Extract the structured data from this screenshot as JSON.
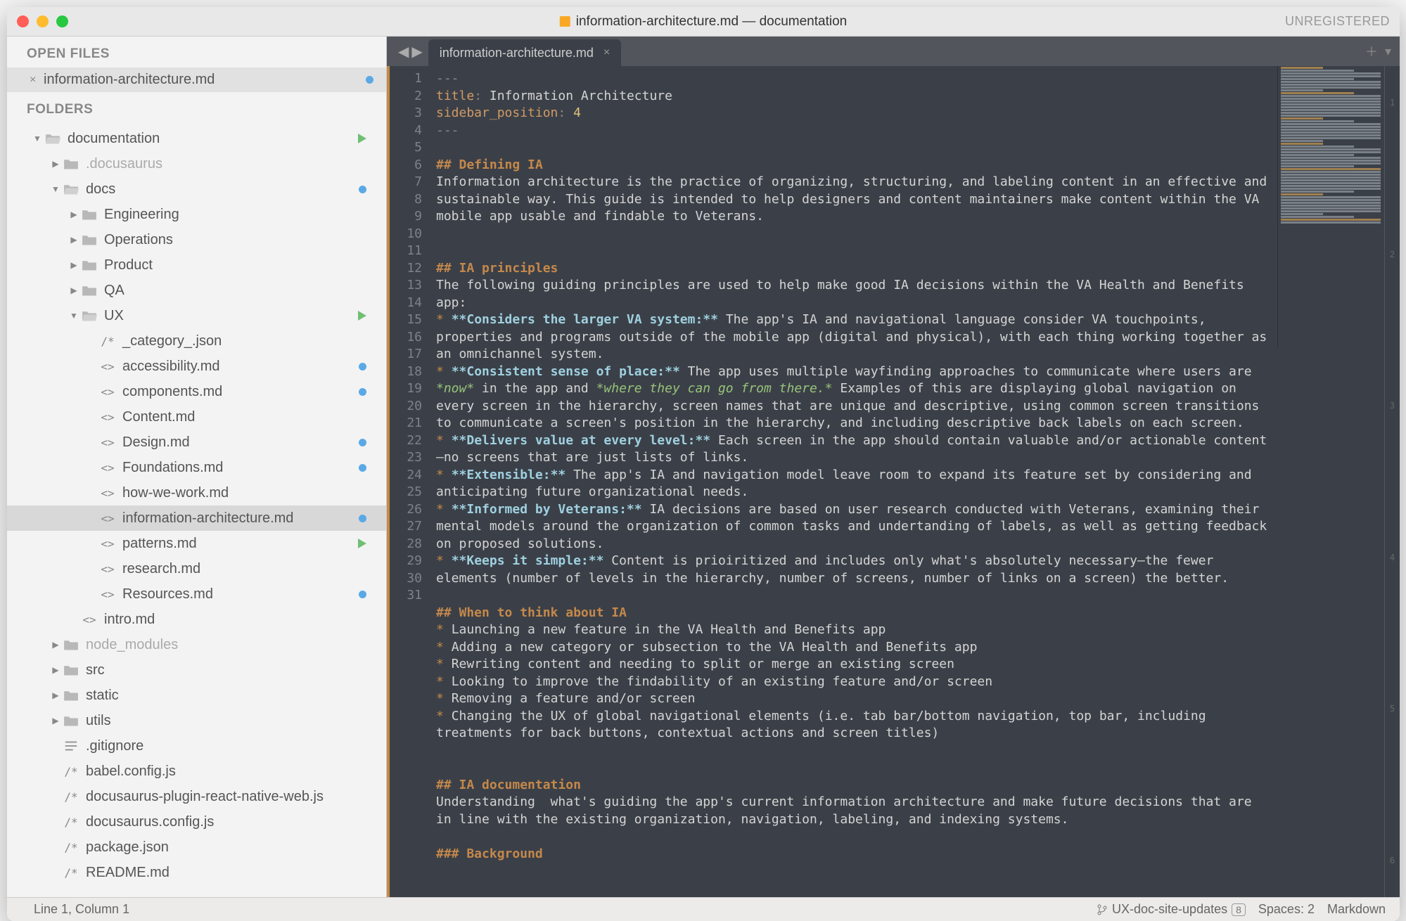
{
  "titlebar": {
    "title": "information-architecture.md — documentation",
    "unregistered": "UNREGISTERED"
  },
  "sidebar": {
    "open_files_header": "OPEN FILES",
    "open_file": "information-architecture.md",
    "folders_header": "FOLDERS",
    "tree": [
      {
        "depth": 1,
        "disc": "down",
        "icon": "folder-open",
        "label": "documentation",
        "badge": "pent"
      },
      {
        "depth": 2,
        "disc": "right",
        "icon": "folder",
        "label": ".docusaurus",
        "dim": true
      },
      {
        "depth": 2,
        "disc": "down",
        "icon": "folder-open",
        "label": "docs",
        "badge": "dot"
      },
      {
        "depth": 3,
        "disc": "right",
        "icon": "folder",
        "label": "Engineering"
      },
      {
        "depth": 3,
        "disc": "right",
        "icon": "folder",
        "label": "Operations"
      },
      {
        "depth": 3,
        "disc": "right",
        "icon": "folder",
        "label": "Product"
      },
      {
        "depth": 3,
        "disc": "right",
        "icon": "folder",
        "label": "QA"
      },
      {
        "depth": 3,
        "disc": "down",
        "icon": "folder-open",
        "label": "UX",
        "badge": "pent"
      },
      {
        "depth": 4,
        "disc": "",
        "icon": "js",
        "label": "_category_.json"
      },
      {
        "depth": 4,
        "disc": "",
        "icon": "angle",
        "label": "accessibility.md",
        "badge": "dot"
      },
      {
        "depth": 4,
        "disc": "",
        "icon": "angle",
        "label": "components.md",
        "badge": "dot"
      },
      {
        "depth": 4,
        "disc": "",
        "icon": "angle",
        "label": "Content.md"
      },
      {
        "depth": 4,
        "disc": "",
        "icon": "angle",
        "label": "Design.md",
        "badge": "dot"
      },
      {
        "depth": 4,
        "disc": "",
        "icon": "angle",
        "label": "Foundations.md",
        "badge": "dot"
      },
      {
        "depth": 4,
        "disc": "",
        "icon": "angle",
        "label": "how-we-work.md"
      },
      {
        "depth": 4,
        "disc": "",
        "icon": "angle",
        "label": "information-architecture.md",
        "badge": "dot",
        "selected": true
      },
      {
        "depth": 4,
        "disc": "",
        "icon": "angle",
        "label": "patterns.md",
        "badge": "pent"
      },
      {
        "depth": 4,
        "disc": "",
        "icon": "angle",
        "label": "research.md"
      },
      {
        "depth": 4,
        "disc": "",
        "icon": "angle",
        "label": "Resources.md",
        "badge": "dot"
      },
      {
        "depth": 3,
        "disc": "",
        "icon": "angle",
        "label": "intro.md"
      },
      {
        "depth": 2,
        "disc": "right",
        "icon": "folder",
        "label": "node_modules",
        "dim": true
      },
      {
        "depth": 2,
        "disc": "right",
        "icon": "folder",
        "label": "src"
      },
      {
        "depth": 2,
        "disc": "right",
        "icon": "folder",
        "label": "static"
      },
      {
        "depth": 2,
        "disc": "right",
        "icon": "folder",
        "label": "utils"
      },
      {
        "depth": 2,
        "disc": "",
        "icon": "lines",
        "label": ".gitignore"
      },
      {
        "depth": 2,
        "disc": "",
        "icon": "js",
        "label": "babel.config.js"
      },
      {
        "depth": 2,
        "disc": "",
        "icon": "js",
        "label": "docusaurus-plugin-react-native-web.js"
      },
      {
        "depth": 2,
        "disc": "",
        "icon": "js",
        "label": "docusaurus.config.js"
      },
      {
        "depth": 2,
        "disc": "",
        "icon": "js",
        "label": "package.json"
      },
      {
        "depth": 2,
        "disc": "",
        "icon": "js",
        "label": "README.md"
      }
    ]
  },
  "tab": {
    "label": "information-architecture.md"
  },
  "code_lines": [
    {
      "n": 1,
      "seg": [
        {
          "c": "punc",
          "t": "---"
        }
      ]
    },
    {
      "n": 2,
      "seg": [
        {
          "c": "key",
          "t": "title"
        },
        {
          "c": "punc",
          "t": ": "
        },
        {
          "c": "",
          "t": "Information Architecture"
        }
      ]
    },
    {
      "n": 3,
      "seg": [
        {
          "c": "key",
          "t": "sidebar_position"
        },
        {
          "c": "punc",
          "t": ": "
        },
        {
          "c": "num",
          "t": "4"
        }
      ]
    },
    {
      "n": 4,
      "seg": [
        {
          "c": "punc",
          "t": "---"
        }
      ]
    },
    {
      "n": 5,
      "seg": []
    },
    {
      "n": 6,
      "seg": [
        {
          "c": "head",
          "t": "## Defining IA"
        }
      ]
    },
    {
      "n": 7,
      "seg": [
        {
          "c": "",
          "t": "Information architecture is the practice of organizing, structuring, and labeling content in an effective and sustainable way. This guide is intended to help designers and content maintainers make content within the VA mobile app usable and findable to Veterans."
        }
      ]
    },
    {
      "n": 8,
      "seg": []
    },
    {
      "n": 9,
      "seg": []
    },
    {
      "n": 10,
      "seg": [
        {
          "c": "head",
          "t": "## IA principles"
        }
      ]
    },
    {
      "n": 11,
      "seg": [
        {
          "c": "",
          "t": "The following guiding principles are used to help make good IA decisions within the VA Health and Benefits app:"
        }
      ]
    },
    {
      "n": 12,
      "seg": [
        {
          "c": "star",
          "t": "* "
        },
        {
          "c": "bold",
          "t": "**Considers the larger VA system:**"
        },
        {
          "c": "",
          "t": " The app's IA and navigational language consider VA touchpoints, properties and programs outside of the mobile app (digital and physical), with each thing working together as an omnichannel system."
        }
      ]
    },
    {
      "n": 13,
      "seg": [
        {
          "c": "star",
          "t": "* "
        },
        {
          "c": "bold",
          "t": "**Consistent sense of place:**"
        },
        {
          "c": "",
          "t": " The app uses multiple wayfinding approaches to communicate where users are "
        },
        {
          "c": "ital",
          "t": "*now*"
        },
        {
          "c": "",
          "t": " in the app and "
        },
        {
          "c": "ital",
          "t": "*where they can go from there.*"
        },
        {
          "c": "",
          "t": " Examples of this are displaying global navigation on every screen in the hierarchy, screen names that are unique and descriptive, using common screen transitions to communicate a screen's position in the hierarchy, and including descriptive back labels on each screen."
        }
      ]
    },
    {
      "n": 14,
      "seg": [
        {
          "c": "star",
          "t": "* "
        },
        {
          "c": "bold",
          "t": "**Delivers value at every level:**"
        },
        {
          "c": "",
          "t": " Each screen in the app should contain valuable and/or actionable content—no screens that are just lists of links."
        }
      ]
    },
    {
      "n": 15,
      "seg": [
        {
          "c": "star",
          "t": "* "
        },
        {
          "c": "bold",
          "t": "**Extensible:**"
        },
        {
          "c": "",
          "t": " The app's IA and navigation model leave room to expand its feature set by considering and anticipating future organizational needs."
        }
      ]
    },
    {
      "n": 16,
      "seg": [
        {
          "c": "star",
          "t": "* "
        },
        {
          "c": "bold",
          "t": "**Informed by Veterans:**"
        },
        {
          "c": "",
          "t": " IA decisions are based on user research conducted with Veterans, examining their mental models around the organization of common tasks and undertanding of labels, as well as getting feedback on proposed solutions."
        }
      ]
    },
    {
      "n": 17,
      "seg": [
        {
          "c": "star",
          "t": "* "
        },
        {
          "c": "bold",
          "t": "**Keeps it simple:**"
        },
        {
          "c": "",
          "t": " Content is prioiritized and includes only what's absolutely necessary—the fewer elements (number of levels in the hierarchy, number of screens, number of links on a screen) the better."
        }
      ]
    },
    {
      "n": 18,
      "seg": []
    },
    {
      "n": 19,
      "seg": [
        {
          "c": "head",
          "t": "## When to think about IA"
        }
      ]
    },
    {
      "n": 20,
      "seg": [
        {
          "c": "star",
          "t": "* "
        },
        {
          "c": "",
          "t": "Launching a new feature in the VA Health and Benefits app"
        }
      ]
    },
    {
      "n": 21,
      "seg": [
        {
          "c": "star",
          "t": "* "
        },
        {
          "c": "",
          "t": "Adding a new category or subsection to the VA Health and Benefits app"
        }
      ]
    },
    {
      "n": 22,
      "seg": [
        {
          "c": "star",
          "t": "* "
        },
        {
          "c": "",
          "t": "Rewriting content and needing to split or merge an existing screen"
        }
      ]
    },
    {
      "n": 23,
      "seg": [
        {
          "c": "star",
          "t": "* "
        },
        {
          "c": "",
          "t": "Looking to improve the findability of an existing feature and/or screen"
        }
      ]
    },
    {
      "n": 24,
      "seg": [
        {
          "c": "star",
          "t": "* "
        },
        {
          "c": "",
          "t": "Removing a feature and/or screen"
        }
      ]
    },
    {
      "n": 25,
      "seg": [
        {
          "c": "star",
          "t": "* "
        },
        {
          "c": "",
          "t": "Changing the UX of global navigational elements (i.e. tab bar/bottom navigation, top bar, including treatments for back buttons, contextual actions and screen titles)"
        }
      ]
    },
    {
      "n": 26,
      "seg": []
    },
    {
      "n": 27,
      "seg": []
    },
    {
      "n": 28,
      "seg": [
        {
          "c": "head",
          "t": "## IA documentation"
        }
      ]
    },
    {
      "n": 29,
      "seg": [
        {
          "c": "",
          "t": "Understanding  what's guiding the app's current information architecture and make future decisions that are in line with the existing organization, navigation, labeling, and indexing systems."
        }
      ]
    },
    {
      "n": 30,
      "seg": []
    },
    {
      "n": 31,
      "seg": [
        {
          "c": "head",
          "t": "### Background"
        }
      ]
    }
  ],
  "statusbar": {
    "cursor": "Line 1, Column 1",
    "branch": "UX-doc-site-updates",
    "branch_count": "8",
    "spaces": "Spaces: 2",
    "syntax": "Markdown"
  }
}
